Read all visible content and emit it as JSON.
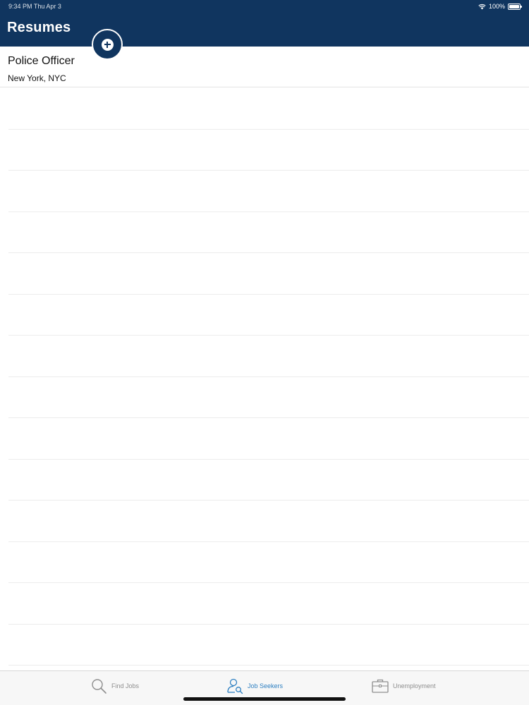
{
  "status_bar": {
    "time": "9:34 PM   Thu Apr 3",
    "battery": "100%"
  },
  "header": {
    "title": "Resumes"
  },
  "resumes": [
    {
      "title": "Police Officer",
      "location": "New York, NYC"
    }
  ],
  "tabs": [
    {
      "label": "Find Jobs",
      "icon": "search-icon",
      "active": false
    },
    {
      "label": "Job Seekers",
      "icon": "person-search-icon",
      "active": true
    },
    {
      "label": "Unemployment",
      "icon": "briefcase-icon",
      "active": false
    }
  ],
  "colors": {
    "header_bg": "#10355f",
    "accent": "#2d7fc1",
    "tab_inactive": "#8e8e8e"
  }
}
